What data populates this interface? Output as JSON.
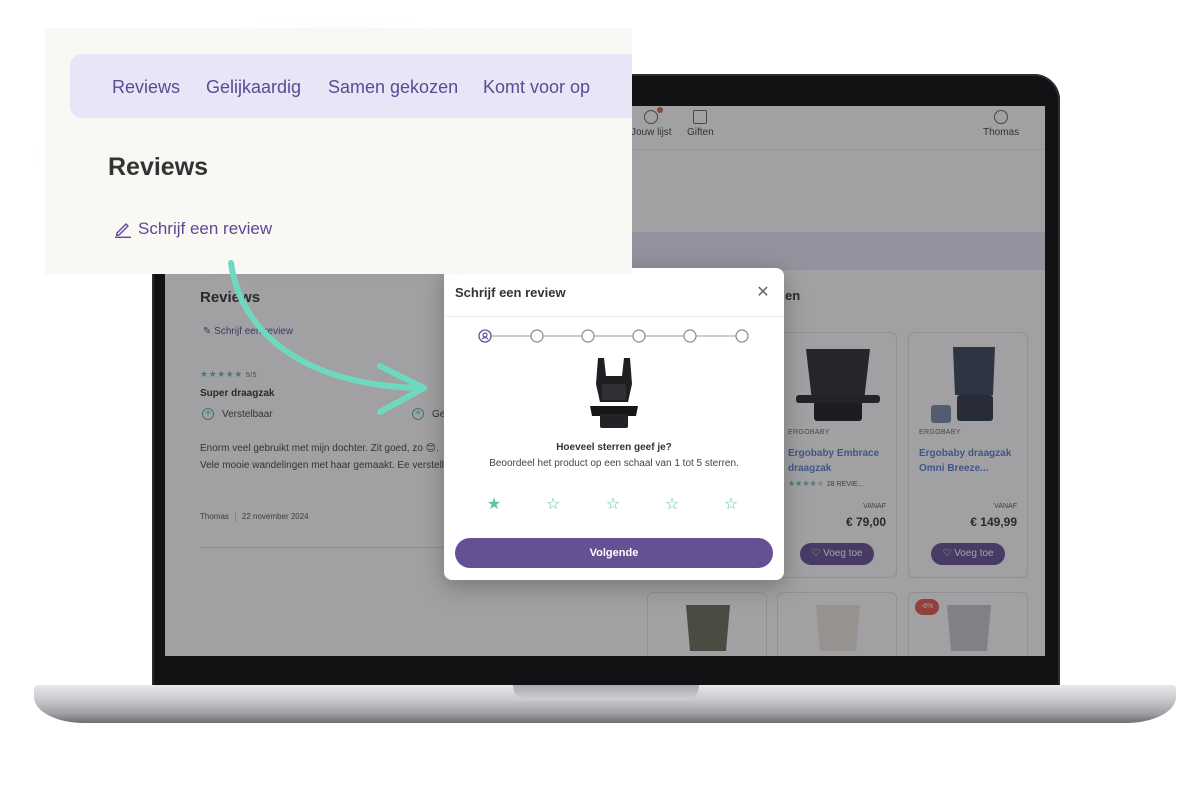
{
  "callout": {
    "tabs": [
      "Reviews",
      "Gelijkaardig",
      "Samen gekozen",
      "Komt voor op"
    ],
    "title": "Reviews",
    "write_review": "Schrijf een review"
  },
  "webpage": {
    "topnav": {
      "wishlist": "Jouw lijst",
      "gifts": "Giften",
      "user": "Thomas"
    },
    "reviews": {
      "title": "Reviews",
      "write_review": "Schrijf een review",
      "rating": "5/5",
      "review_title": "Super draagzak",
      "pro_1": "Verstelbaar",
      "pro_2": "Ge",
      "body": "Enorm veel gebruikt met mijn dochter. Zit goed, zo 😊. Vele mooie wandelingen met haar gemaakt. Ee verstellen.",
      "author": "Thomas",
      "date": "22 november 2024"
    },
    "section_tail": "en",
    "products": [
      {
        "brand": "ERGOBABY",
        "name": "Ergobaby Embrace draagzak",
        "reviews": "28 REVIE...",
        "price_from": "VANAF",
        "price": "€ 79,00",
        "add": "Voeg toe"
      },
      {
        "brand": "ERGOBABY",
        "name": "Ergobaby draagzak Omni Breeze...",
        "price_from": "VANAF",
        "price": "€ 149,99",
        "add": "Voeg toe"
      }
    ],
    "sale_badge": "-6%"
  },
  "modal": {
    "title": "Schrijf een review",
    "question": "Hoeveel sterren geef je?",
    "hint": "Beoordeel het product op een schaal van 1 tot 5 sterren.",
    "next_button": "Volgende",
    "current_step": 1,
    "total_steps": 6,
    "selected_stars": 1,
    "max_stars": 5
  },
  "colors": {
    "accent": "#655094",
    "star": "#5cc3a6",
    "arrow": "#6fd8c0",
    "tab_band": "#e8e6f6",
    "sale": "#e55a4a"
  },
  "icons": {
    "close": "close-icon",
    "pencil": "pencil-icon",
    "star": "star-icon",
    "step": "step-icon",
    "heart": "heart-icon",
    "gift": "gift-icon",
    "user": "user-icon"
  }
}
